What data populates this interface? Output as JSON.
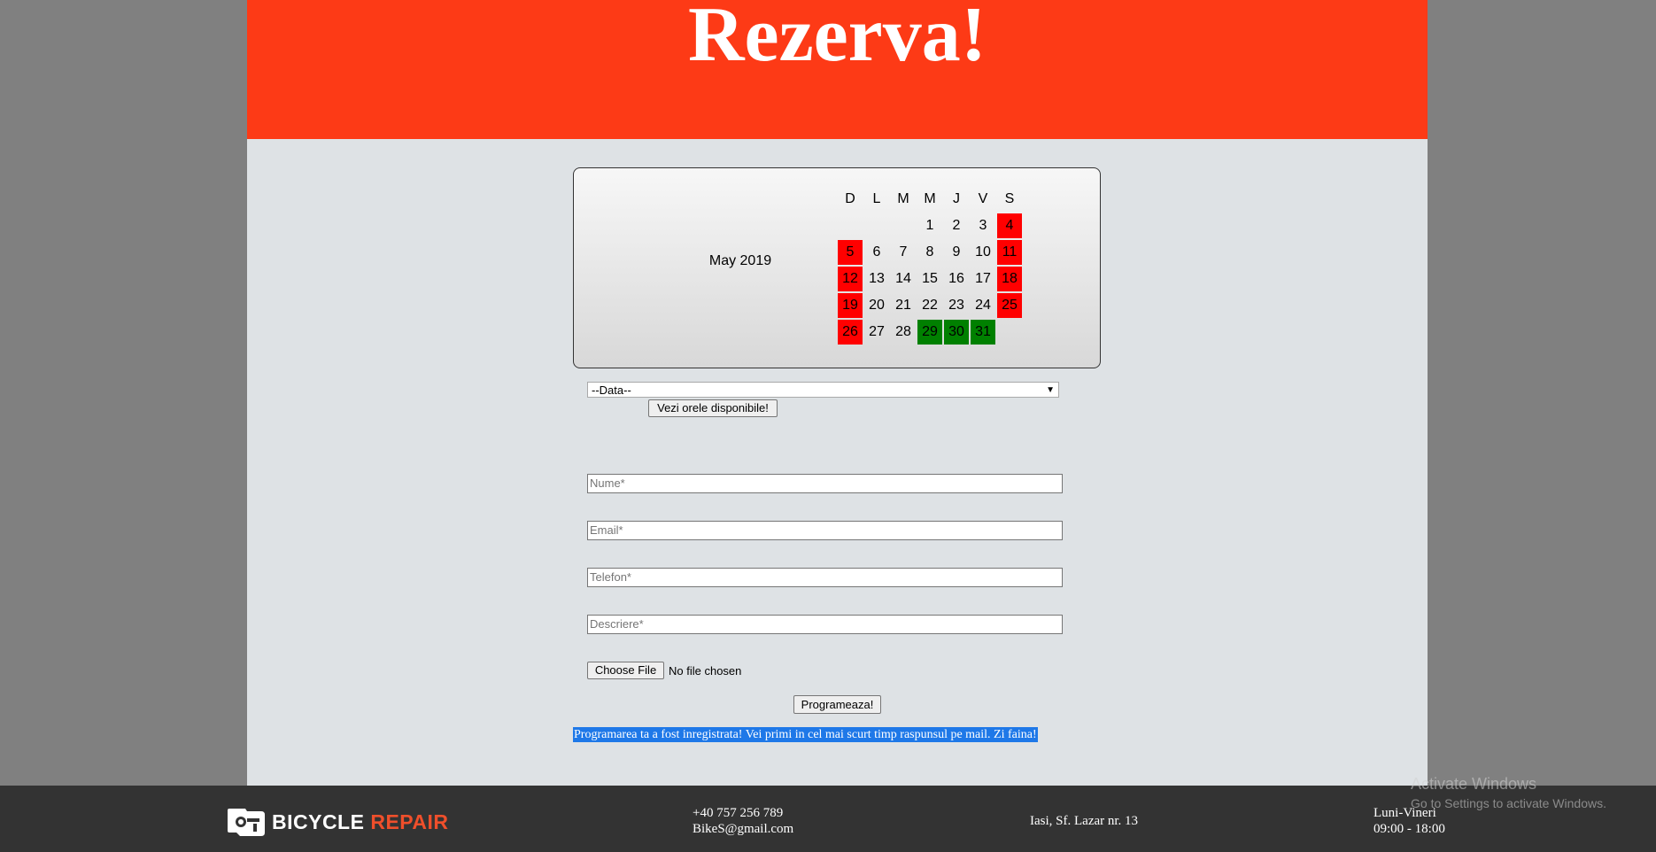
{
  "header": {
    "title": "Rezerva!"
  },
  "calendar": {
    "month_label": "May 2019",
    "weekdays": [
      "D",
      "L",
      "M",
      "M",
      "J",
      "V",
      "S"
    ],
    "start_weekday_index": 3,
    "days_in_month": 31,
    "red_days": [
      4,
      5,
      11,
      12,
      18,
      19,
      25,
      26
    ],
    "green_days": [
      29,
      30,
      31
    ],
    "colors": {
      "red": "#ff0000",
      "green": "#008000"
    }
  },
  "date_select": {
    "value": "--Data--"
  },
  "buttons": {
    "show_hours": "Vezi orele disponibile!",
    "choose_file": "Choose File",
    "submit": "Programeaza!"
  },
  "form": {
    "name_placeholder": "Nume*",
    "email_placeholder": "Email*",
    "phone_placeholder": "Telefon*",
    "description_placeholder": "Descriere*",
    "file_status": "No file chosen"
  },
  "confirmation": "Programarea ta a fost inregistrata! Vei primi in cel mai scurt timp raspunsul pe mail. Zi faina!",
  "footer": {
    "logo": {
      "word1": "BICYCLE",
      "word2": "REPAIR"
    },
    "phone": "+40 757 256 789",
    "email": "BikeS@gmail.com",
    "address": "Iasi, Sf. Lazar nr. 13",
    "days": "Luni-Vineri",
    "hours": "09:00 - 18:00"
  },
  "watermark": {
    "title": "Activate Windows",
    "subtitle": "Go to Settings to activate Windows."
  },
  "colors": {
    "header_bg": "#fd3a16",
    "page_bg": "#dee2e5",
    "side_bg": "#808080",
    "footer_bg": "#333333",
    "logo_accent": "#ef4f2b",
    "selection": "#1e78e8"
  }
}
